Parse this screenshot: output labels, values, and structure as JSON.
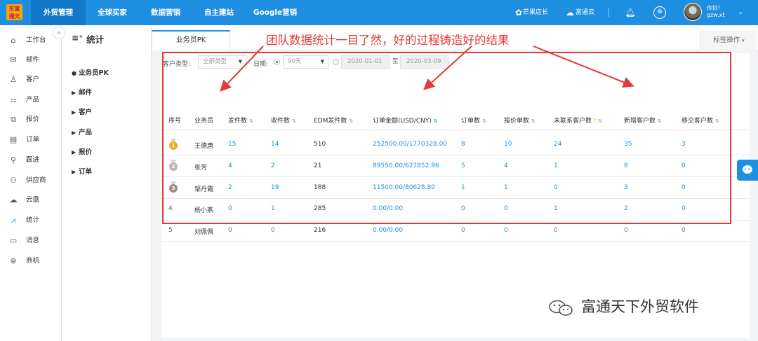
{
  "topbar": {
    "logo_text": "东富通天",
    "nav": [
      "外贸管理",
      "全球买家",
      "数据营销",
      "自主建站",
      "Google营销"
    ],
    "store_label": "芒果店长",
    "cloud_label": "富通云",
    "user_greeting": "你好!",
    "user_name": "gzw.xt",
    "accent": "#1e8ee0"
  },
  "sidebar": {
    "items": [
      {
        "label": "工作台",
        "icon": "home-icon"
      },
      {
        "label": "邮件",
        "icon": "mail-icon"
      },
      {
        "label": "客户",
        "icon": "customer-icon"
      },
      {
        "label": "产品",
        "icon": "product-icon"
      },
      {
        "label": "报价",
        "icon": "quote-icon"
      },
      {
        "label": "订单",
        "icon": "order-icon"
      },
      {
        "label": "跟进",
        "icon": "location-icon"
      },
      {
        "label": "供应商",
        "icon": "supplier-icon"
      },
      {
        "label": "云盘",
        "icon": "cloud-icon"
      },
      {
        "label": "统计",
        "icon": "chart-icon"
      },
      {
        "label": "消息",
        "icon": "message-icon"
      },
      {
        "label": "商机",
        "icon": "opportunity-icon"
      }
    ],
    "active": "统计"
  },
  "subsidebar": {
    "title": "统计",
    "items": [
      "业务员PK",
      "邮件",
      "客户",
      "产品",
      "报价",
      "订单"
    ]
  },
  "tabs": {
    "active": "业务员PK",
    "tag_op": "标签操作"
  },
  "filters": {
    "customer_type_label": "客户类型:",
    "customer_type_value": "全部类型",
    "date_label": "日期:",
    "range_value": "90天",
    "date_from": "2020-01-01",
    "date_to_sep": "至",
    "date_to": "2020-03-09"
  },
  "table": {
    "headers": [
      "序号",
      "业务员",
      "发件数",
      "收件数",
      "EDM发件数",
      "订单金额(USD/CNY)",
      "订单数",
      "报价单数",
      "未联系客户数",
      "新增客户数",
      "移交客户数"
    ],
    "rows": [
      {
        "rank": "1",
        "name": "王德唐",
        "sent": "15",
        "received": "14",
        "edm": "510",
        "amount": "252500.00/1770328.00",
        "orders": "8",
        "quotes": "10",
        "uncontacted": "24",
        "new_customers": "35",
        "transferred": "3"
      },
      {
        "rank": "2",
        "name": "张芳",
        "sent": "4",
        "received": "2",
        "edm": "21",
        "amount": "89550.00/627852.96",
        "orders": "5",
        "quotes": "4",
        "uncontacted": "1",
        "new_customers": "8",
        "transferred": "0"
      },
      {
        "rank": "3",
        "name": "邹丹霞",
        "sent": "2",
        "received": "19",
        "edm": "188",
        "amount": "11500.00/80628.80",
        "orders": "1",
        "quotes": "1",
        "uncontacted": "0",
        "new_customers": "3",
        "transferred": "0"
      },
      {
        "rank": "4",
        "name": "杨小燕",
        "sent": "0",
        "received": "1",
        "edm": "285",
        "amount": "0.00/0.00",
        "orders": "0",
        "quotes": "0",
        "uncontacted": "1",
        "new_customers": "2",
        "transferred": "0"
      },
      {
        "rank": "5",
        "name": "刘佩佩",
        "sent": "0",
        "received": "0",
        "edm": "216",
        "amount": "0.00/0.00",
        "orders": "0",
        "quotes": "0",
        "uncontacted": "0",
        "new_customers": "0",
        "transferred": "0"
      }
    ]
  },
  "annotation": {
    "text": "团队数据统计一目了然，好的过程铸造好的结果",
    "color": "#e03a3a"
  },
  "watermark": {
    "text": "富通天下外贸软件"
  }
}
